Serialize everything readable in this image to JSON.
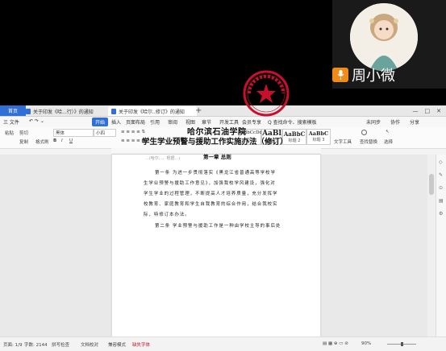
{
  "call": {
    "participant_name": "周小微"
  },
  "tabs": {
    "home": "首页",
    "doc1": "关于印发《哈...行）》的通知",
    "doc2": "关于印发《哈尔..修订》的通知",
    "add": "+"
  },
  "window_controls": {
    "minimize": "—",
    "restore": "□",
    "close": "✕"
  },
  "menubar": {
    "file": "三 文件",
    "start": "开始",
    "insert": "插入",
    "layout": "页面布局",
    "reference": "引用",
    "review": "审阅",
    "view": "视图",
    "section": "章节",
    "devtools": "开发工具",
    "member": "会员专享",
    "search": "Q 查找命令、搜索模板",
    "unsynced": "未同步",
    "collab": "协作",
    "share": "分享"
  },
  "ribbon": {
    "cut": "剪切",
    "paste": "粘贴",
    "copy": "复制",
    "format_painter": "格式刷",
    "font_name": "黑体",
    "font_size": "小四",
    "styles": [
      {
        "sample": "AaBbCcDd",
        "name": "正文"
      },
      {
        "sample": "AaBl",
        "name": "标题 1"
      },
      {
        "sample": "AaBbC",
        "name": "标题 2"
      },
      {
        "sample": "AaBbC",
        "name": "标题 3"
      }
    ],
    "text_tools": "文字工具",
    "find_replace": "查找替换",
    "select": "选择"
  },
  "document": {
    "top_fragment": "...(哈尔...、根据...)",
    "seal_text": "哈尔滨石油学院",
    "school": "哈尔滨石油学院",
    "title": "学生学业预警与援助工作实施办法（修订）",
    "chapter": "第一章  总则",
    "para1_line1": "第一条   为进一步贯彻落实《黑龙江省普通高等学校学",
    "para1_line2": "生学业预警与援助工作意见》，加强我校学风建设，强化对",
    "para1_line3": "学生学业的过程管理，不断提高人才培养质量，充分发挥学",
    "para1_line4": "校教育、家庭教育和学生自我教育的综合作用，结合我校实",
    "para1_line5": "际，特修订本办法。",
    "para2_line1": "第二条   学业预警与援助工作是一种由学校主导的事后处"
  },
  "status": {
    "page": "页面: 1/9",
    "words": "字数: 2144",
    "spellcheck": "拼写检查",
    "doc_check": "文档校对",
    "compat": "兼容模式",
    "missing_font": "缺失字体",
    "zoom": "90%"
  },
  "colors": {
    "accent": "#2f6fd6",
    "seal_red": "#c8102e",
    "mic_orange": "#f08a18"
  }
}
